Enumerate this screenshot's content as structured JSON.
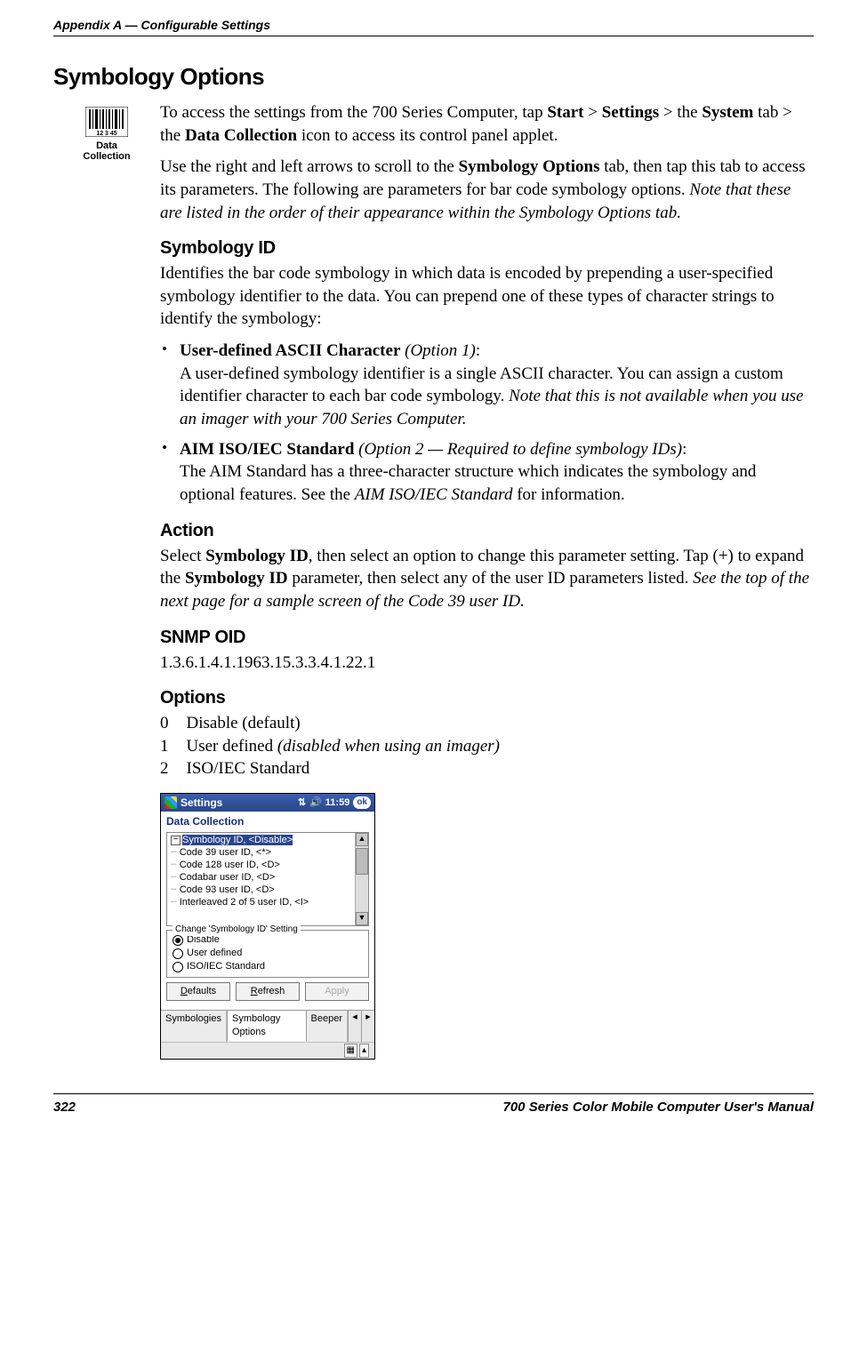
{
  "header": {
    "appendix": "Appendix  A",
    "sep": " — ",
    "chapter": "Configurable Settings"
  },
  "section_title": "Symbology Options",
  "icon_caption_line1": "Data",
  "icon_caption_line2": "Collection",
  "intro": {
    "p1_pre": "To access the settings from the 700 Series Computer, tap ",
    "start": "Start",
    "gt1": " > ",
    "settings": "Settings",
    "gt2": " > the ",
    "system": "System",
    "mid": " tab > the ",
    "datacoll": "Data Collection",
    "p1_post": " icon to access its control panel applet.",
    "p2_pre": "Use the right and left arrows to scroll to the ",
    "symopt": "Symbology Options",
    "p2_mid": " tab, then tap this tab to access its parameters. The following are parameters for bar code symbology options. ",
    "p2_ital": "Note that these are listed in the order of their appearance within the Symbology Options tab."
  },
  "symid": {
    "heading": "Symbology ID",
    "body": "Identifies the bar code symbology in which data is encoded by prepending a user-specified symbology identifier to the data. You can prepend one of these types of character strings to identify the symbology:",
    "b1_bold": "User-defined ASCII Character",
    "b1_ital": " (Option 1)",
    "b1_colon": ":",
    "b1_body_pre": "A user-defined symbology identifier is a single ASCII character. You can assign a custom identifier character to each bar code symbology. ",
    "b1_body_ital": "Note that this is not available when you use an imager with your 700 Series Computer.",
    "b2_bold": "AIM ISO/IEC Standard",
    "b2_ital": " (Option 2 — Required to define symbology IDs)",
    "b2_colon": ":",
    "b2_body_pre": "The AIM Standard has a three-character structure which indicates the symbology and optional features. See the ",
    "b2_body_ital": "AIM ISO/IEC Standard",
    "b2_body_post": " for information."
  },
  "action": {
    "heading": "Action",
    "pre1": "Select ",
    "bold1": "Symbology ID",
    "mid1": ", then select an option to change this parameter setting. Tap (+) to expand the ",
    "bold2": "Symbology ID",
    "mid2": " parameter, then select any of the user ID parameters listed. ",
    "ital": "See the top of the next page for a sample screen of the Code 39 user ID."
  },
  "snmp": {
    "heading": "SNMP OID",
    "value": "1.3.6.1.4.1.1963.15.3.3.4.1.22.1"
  },
  "options": {
    "heading": "Options",
    "rows": [
      {
        "n": "0",
        "text": "Disable (default)",
        "ital": ""
      },
      {
        "n": "1",
        "text": "User defined ",
        "ital": "(disabled when using an imager)"
      },
      {
        "n": "2",
        "text": "ISO/IEC Standard",
        "ital": ""
      }
    ]
  },
  "ppc": {
    "title": "Settings",
    "clock": "11:59",
    "ok": "ok",
    "app": "Data Collection",
    "tree": [
      "Symbology ID, <Disable>",
      "Code 39 user ID, <*>",
      "Code 128 user ID, <D>",
      "Codabar user ID, <D>",
      "Code 93 user ID, <D>",
      "Interleaved 2 of 5 user ID, <I>"
    ],
    "legend": "Change 'Symbology ID' Setting",
    "radios": [
      "Disable",
      "User defined",
      "ISO/IEC Standard"
    ],
    "buttons": {
      "defaults": "Defaults",
      "refresh": "Refresh",
      "apply": "Apply"
    },
    "tabs": [
      "Symbologies",
      "Symbology Options",
      "Beeper"
    ]
  },
  "footer": {
    "page": "322",
    "title": "700 Series Color Mobile Computer User's Manual"
  }
}
